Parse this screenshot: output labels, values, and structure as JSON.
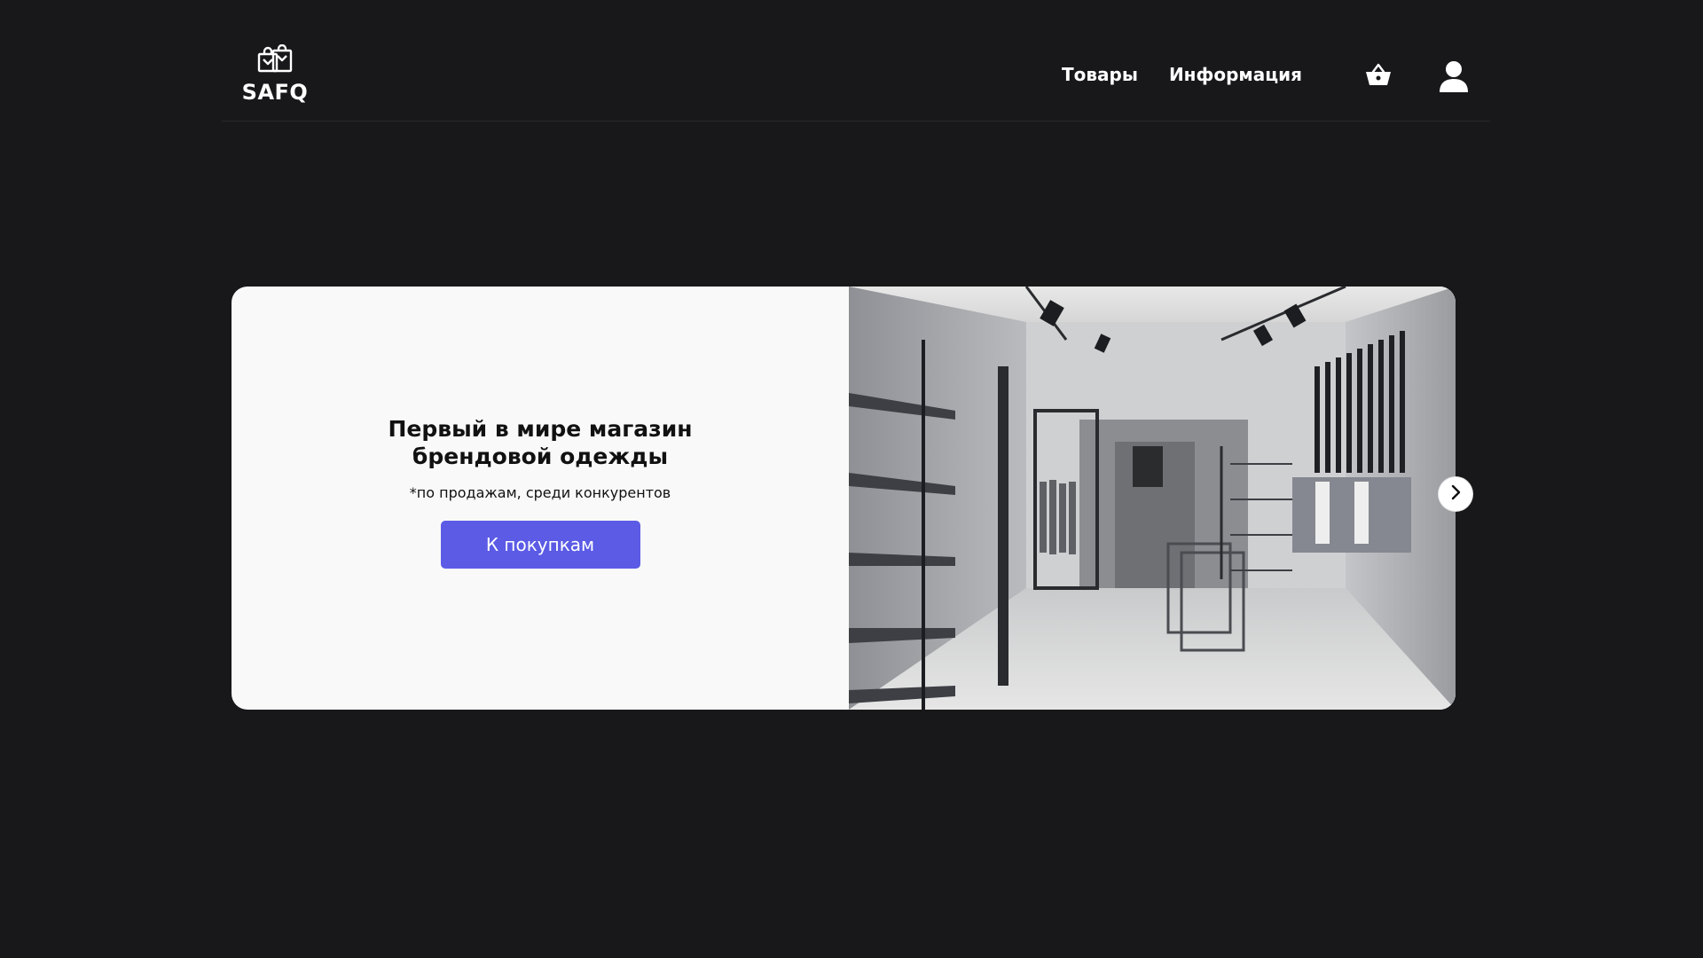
{
  "header": {
    "brand": "SAFQ",
    "nav": [
      {
        "label": "Товары"
      },
      {
        "label": "Информация"
      }
    ],
    "icons": {
      "logo": "shopping-bags-icon",
      "cart": "basket-icon",
      "user": "user-icon"
    }
  },
  "hero": {
    "title": "Первый в мире магазин брендовой одежды",
    "subtitle": "*по продажам, среди конкурентов",
    "cta_label": "К покупкам",
    "image": "clothing-store-interior",
    "next_icon": "chevron-right-icon"
  },
  "colors": {
    "background": "#18181b",
    "accent": "#5b5be6",
    "card": "#f9f9f9"
  }
}
